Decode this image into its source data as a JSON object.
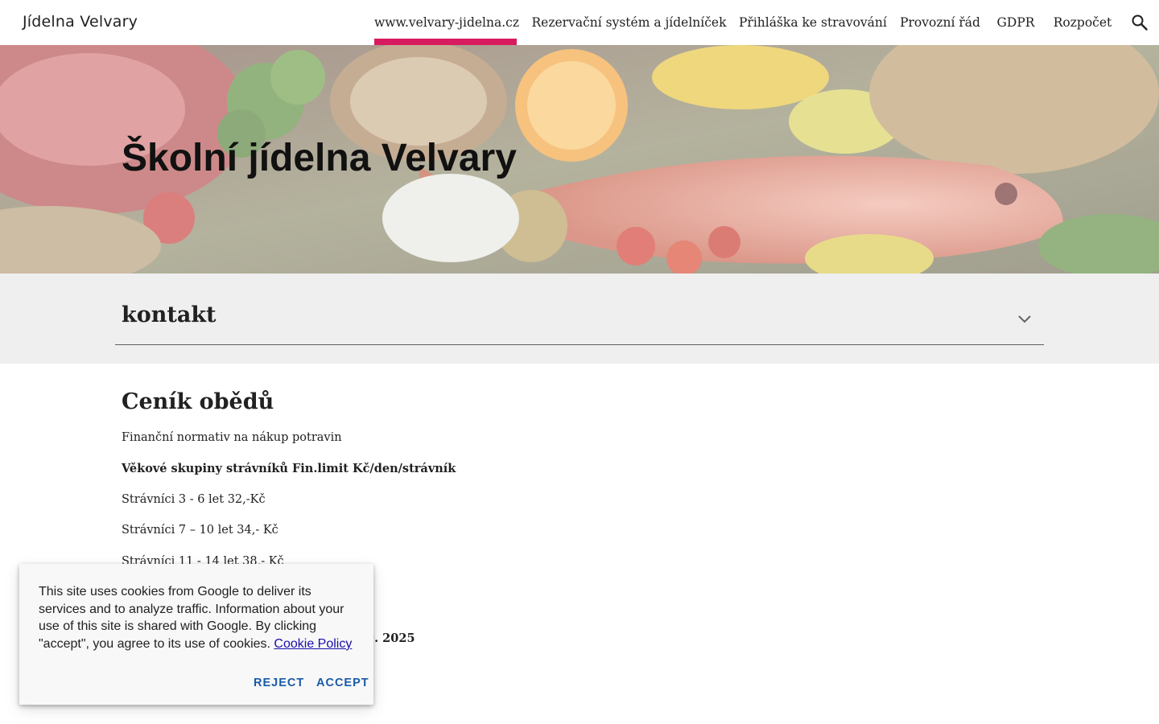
{
  "header": {
    "site_title": "Jídelna Velvary",
    "nav": [
      {
        "label": "www.velvary-jidelna.cz",
        "active": true
      },
      {
        "label": "Rezervační systém a jídelníček",
        "active": false
      },
      {
        "label": "Přihláška ke stravování",
        "active": false
      },
      {
        "label": "Provozní řád",
        "active": false
      },
      {
        "label": "GDPR",
        "active": false
      },
      {
        "label": "Rozpočet",
        "active": false
      }
    ],
    "search_icon": "search-icon",
    "accent_color": "#d81b60"
  },
  "hero": {
    "title": "Školní jídelna Velvary",
    "image": "food-still-life-banner"
  },
  "collapsible": {
    "title": "kontakt",
    "icon": "chevron-down-icon",
    "expanded": false
  },
  "content": {
    "heading": "Ceník obědů",
    "paragraphs": [
      {
        "text": "Finanční normativ na nákup potravin",
        "bold": false
      },
      {
        "text": "Věkové skupiny strávníků Fin.limit Kč/den/strávník",
        "bold": true
      },
      {
        "text": "Strávníci 3 - 6 let 32,-Kč",
        "bold": false
      },
      {
        "text": "Strávníci 7 – 10 let 34,- Kč",
        "bold": false
      },
      {
        "text": "Strávníci 11 - 14 let 38,- Kč",
        "bold": false
      },
      {
        "text": "9. 2025",
        "bold": true
      }
    ]
  },
  "cookie_banner": {
    "text": "This site uses cookies from Google to deliver its services and to analyze traffic. Information about your use of this site is shared with Google. By clicking \"accept\", you agree to its use of cookies.",
    "link_label": "Cookie Policy",
    "reject_label": "REJECT",
    "accept_label": "ACCEPT"
  }
}
